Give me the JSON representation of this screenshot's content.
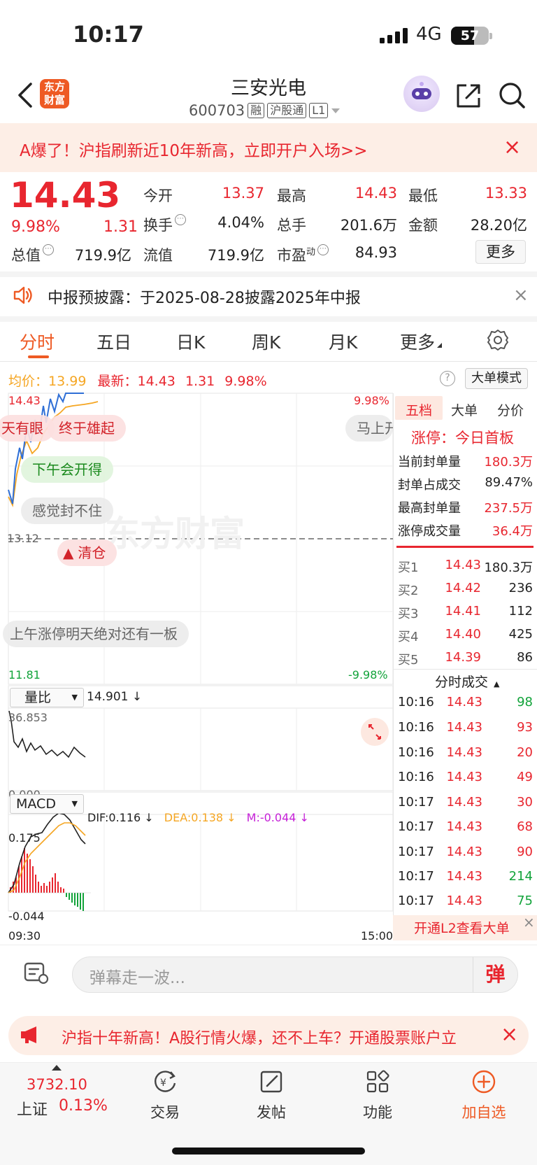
{
  "status_bar": {
    "time": "10:17",
    "network": "4G",
    "battery": "57"
  },
  "header": {
    "stock_name": "三安光电",
    "stock_code": "600703",
    "tags": [
      "融",
      "沪股通",
      "L1"
    ],
    "app_logo_line1": "东方",
    "app_logo_line2": "财富"
  },
  "promo": {
    "text": "A爆了！沪指刷新近10年新高，立即开户入场>>",
    "close": "×"
  },
  "quote": {
    "price": "14.43",
    "change_pct": "9.98%",
    "change": "1.31",
    "fields": [
      {
        "label": "今开",
        "value": "13.37",
        "color": "red"
      },
      {
        "label": "最高",
        "value": "14.43",
        "color": "red"
      },
      {
        "label": "最低",
        "value": "13.33",
        "color": "red"
      },
      {
        "label": "换手",
        "value": "4.04%",
        "color": "black"
      },
      {
        "label": "总手",
        "value": "201.6万",
        "color": "black"
      },
      {
        "label": "金额",
        "value": "28.20亿",
        "color": "black"
      },
      {
        "label": "总值",
        "value": "719.9亿",
        "color": "black"
      },
      {
        "label": "流值",
        "value": "719.9亿",
        "color": "black"
      },
      {
        "label": "市盈",
        "value": "84.93",
        "color": "black"
      }
    ],
    "pe_sup": "动",
    "more_label": "更多"
  },
  "notice": {
    "text": "中报预披露：于2025-08-28披露2025年中报",
    "close": "×"
  },
  "tabs": [
    "分时",
    "五日",
    "日K",
    "周K",
    "月K",
    "更多"
  ],
  "chart_header": {
    "avg_label": "均价：",
    "avg_value": "13.99",
    "latest_label": "最新：",
    "latest_value": "14.43",
    "latest_change": "1.31",
    "latest_pct": "9.98%",
    "help": "?",
    "big_order_mode": "大单模式"
  },
  "chart_labels": {
    "top_price": "14.43",
    "top_pct": "9.98%",
    "mid_price": "13.12",
    "bottom_price": "11.81",
    "bottom_pct": "-9.98%",
    "watermark": "东方财富",
    "volume_ratio_label": "量比",
    "volume_ratio_value": "14.901 ↓",
    "vol_max": "36.853",
    "vol_min": "0.000",
    "macd_label": "MACD",
    "dif": "DIF:0.116 ↓",
    "dea": "DEA:0.138 ↓",
    "m": "M:-0.044 ↓",
    "macd_max": "0.175",
    "macd_min": "-0.044",
    "time_start": "09:30",
    "time_end": "15:00"
  },
  "danmu": [
    "天有眼",
    "终于雄起",
    "马上开",
    "下午会开得",
    "感觉封不住",
    "清仓",
    "上午涨停明天绝对还有一板"
  ],
  "right_panel": {
    "tabs": [
      "五档",
      "大单",
      "分价"
    ],
    "limit_title": "涨停：今日首板",
    "stats": [
      {
        "label": "当前封单量",
        "value": "180.3万"
      },
      {
        "label": "封单占成交",
        "value": "89.47%"
      },
      {
        "label": "最高封单量",
        "value": "237.5万"
      },
      {
        "label": "涨停成交量",
        "value": "36.4万"
      }
    ],
    "bids": [
      {
        "label": "买1",
        "price": "14.43",
        "vol": "180.3万"
      },
      {
        "label": "买2",
        "price": "14.42",
        "vol": "236"
      },
      {
        "label": "买3",
        "price": "14.41",
        "vol": "112"
      },
      {
        "label": "买4",
        "price": "14.40",
        "vol": "425"
      },
      {
        "label": "买5",
        "price": "14.39",
        "vol": "86"
      }
    ],
    "trades_title": "分时成交",
    "trades": [
      {
        "time": "10:16",
        "price": "14.43",
        "vol": "98"
      },
      {
        "time": "10:16",
        "price": "14.43",
        "vol": "93"
      },
      {
        "time": "10:16",
        "price": "14.43",
        "vol": "20"
      },
      {
        "time": "10:16",
        "price": "14.43",
        "vol": "49"
      },
      {
        "time": "10:17",
        "price": "14.43",
        "vol": "30"
      },
      {
        "time": "10:17",
        "price": "14.43",
        "vol": "68"
      },
      {
        "time": "10:17",
        "price": "14.43",
        "vol": "90"
      },
      {
        "time": "10:17",
        "price": "14.43",
        "vol": "214"
      },
      {
        "time": "10:17",
        "price": "14.43",
        "vol": "75"
      }
    ],
    "upgrade": "开通L2查看大单"
  },
  "comment": {
    "placeholder": "弹幕走一波...",
    "danmu_btn": "弹"
  },
  "ad": {
    "text": "沪指十年新高！A股行情火爆，还不上车？开通股票账户立",
    "close": "×"
  },
  "bottom_nav": {
    "index_value": "3732.10",
    "index_name": "上证",
    "index_pct": "0.13%",
    "items": [
      "交易",
      "发帖",
      "功能",
      "加自选"
    ]
  },
  "colors": {
    "up": "#e8262f",
    "down": "#12a33a",
    "accent": "#ee5a24",
    "price_line": "#2f6fd6",
    "avg_line": "#f5a623"
  }
}
